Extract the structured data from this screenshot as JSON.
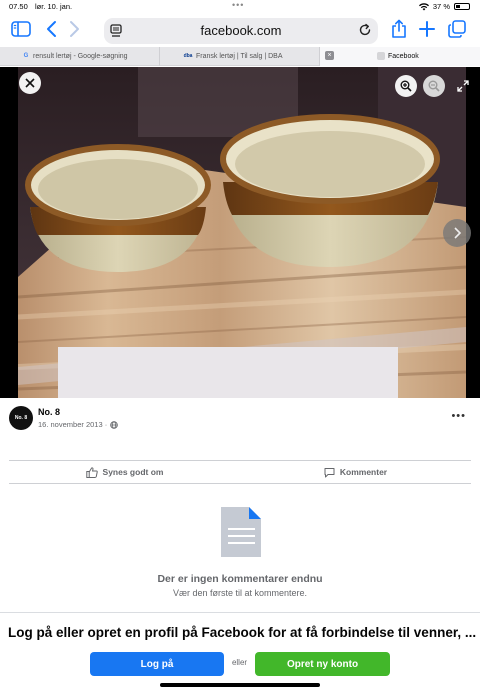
{
  "status": {
    "time": "07.50",
    "date": "lør. 10. jan.",
    "battery": "37 %",
    "battery_level": 0.37
  },
  "browser": {
    "url": "facebook.com"
  },
  "tabs": [
    {
      "label": "rensult lertøj - Google-søgning"
    },
    {
      "label": "Fransk lertøj | Til salg | DBA"
    },
    {
      "label": "Facebook"
    }
  ],
  "post": {
    "author": "No. 8",
    "date": "16. november 2013 ·",
    "avatar_text": "No. 8"
  },
  "actions": {
    "like": "Synes godt om",
    "comment": "Kommenter"
  },
  "comments": {
    "empty_title": "Der er ingen kommentarer endnu",
    "empty_sub": "Vær den første til at kommentere."
  },
  "login_banner": {
    "text": "Log på eller opret en profil på Facebook for at få forbindelse til venner, ...",
    "login": "Log på",
    "or": "eller",
    "create": "Opret ny konto"
  },
  "colors": {
    "accent": "#1877f2",
    "create": "#42b72a",
    "safari_blue": "#1677ff"
  }
}
